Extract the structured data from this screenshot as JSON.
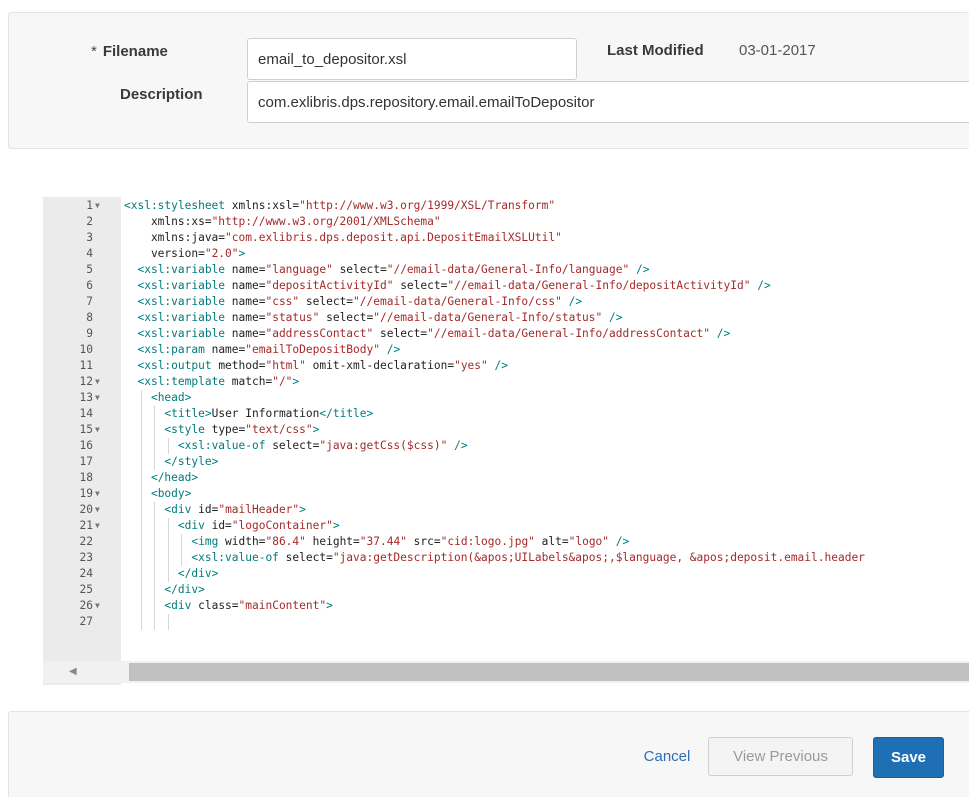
{
  "form": {
    "filename_label": "Filename",
    "required_marker": "*",
    "filename_value": "email_to_depositor.xsl",
    "last_modified_label": "Last Modified",
    "last_modified_value": "03-01-2017",
    "description_label": "Description",
    "description_value": "com.exlibris.dps.repository.email.emailToDepositor"
  },
  "editor": {
    "lines": [
      {
        "num": "1",
        "fold": true,
        "indent": 0,
        "text": "<xsl:stylesheet xmlns:xsl=\"http://www.w3.org/1999/XSL/Transform\""
      },
      {
        "num": "2",
        "fold": false,
        "indent": 0,
        "text": "    xmlns:xs=\"http://www.w3.org/2001/XMLSchema\""
      },
      {
        "num": "3",
        "fold": false,
        "indent": 0,
        "text": "    xmlns:java=\"com.exlibris.dps.deposit.api.DepositEmailXSLUtil\""
      },
      {
        "num": "4",
        "fold": false,
        "indent": 0,
        "text": "    version=\"2.0\">"
      },
      {
        "num": "5",
        "fold": false,
        "indent": 1,
        "text": "<xsl:variable name=\"language\" select=\"//email-data/General-Info/language\" />"
      },
      {
        "num": "6",
        "fold": false,
        "indent": 1,
        "text": "<xsl:variable name=\"depositActivityId\" select=\"//email-data/General-Info/depositActivityId\" />"
      },
      {
        "num": "7",
        "fold": false,
        "indent": 1,
        "text": "<xsl:variable name=\"css\" select=\"//email-data/General-Info/css\" />"
      },
      {
        "num": "8",
        "fold": false,
        "indent": 1,
        "text": "<xsl:variable name=\"status\" select=\"//email-data/General-Info/status\" />"
      },
      {
        "num": "9",
        "fold": false,
        "indent": 1,
        "text": "<xsl:variable name=\"addressContact\" select=\"//email-data/General-Info/addressContact\" />"
      },
      {
        "num": "10",
        "fold": false,
        "indent": 1,
        "text": "<xsl:param name=\"emailToDepositBody\" />"
      },
      {
        "num": "11",
        "fold": false,
        "indent": 1,
        "text": "<xsl:output method=\"html\" omit-xml-declaration=\"yes\" />"
      },
      {
        "num": "12",
        "fold": true,
        "indent": 1,
        "text": "<xsl:template match=\"/\">"
      },
      {
        "num": "13",
        "fold": true,
        "indent": 2,
        "text": "<head>"
      },
      {
        "num": "14",
        "fold": false,
        "indent": 3,
        "text": "<title>User Information</title>"
      },
      {
        "num": "15",
        "fold": true,
        "indent": 3,
        "text": "<style type=\"text/css\">"
      },
      {
        "num": "16",
        "fold": false,
        "indent": 4,
        "text": "<xsl:value-of select=\"java:getCss($css)\" />"
      },
      {
        "num": "17",
        "fold": false,
        "indent": 3,
        "text": "</style>"
      },
      {
        "num": "18",
        "fold": false,
        "indent": 2,
        "text": "</head>"
      },
      {
        "num": "19",
        "fold": true,
        "indent": 2,
        "text": "<body>"
      },
      {
        "num": "20",
        "fold": true,
        "indent": 3,
        "text": "<div id=\"mailHeader\">"
      },
      {
        "num": "21",
        "fold": true,
        "indent": 4,
        "text": "<div id=\"logoContainer\">"
      },
      {
        "num": "22",
        "fold": false,
        "indent": 5,
        "text": "<img width=\"86.4\" height=\"37.44\" src=\"cid:logo.jpg\" alt=\"logo\" />"
      },
      {
        "num": "23",
        "fold": false,
        "indent": 5,
        "text": "<xsl:value-of select=\"java:getDescription(&apos;UILabels&apos;,$language, &apos;deposit.email.header"
      },
      {
        "num": "24",
        "fold": false,
        "indent": 4,
        "text": "</div>"
      },
      {
        "num": "25",
        "fold": false,
        "indent": 3,
        "text": "</div>"
      },
      {
        "num": "26",
        "fold": true,
        "indent": 3,
        "text": "<div class=\"mainContent\">"
      },
      {
        "num": "27",
        "fold": false,
        "indent": 4,
        "text": ""
      }
    ]
  },
  "footer": {
    "cancel_label": "Cancel",
    "view_previous_label": "View Previous",
    "save_label": "Save"
  },
  "colors": {
    "primary": "#1f6fb5",
    "link": "#2d6fb3",
    "tag": "#007b7b",
    "string": "#a52a2a"
  }
}
